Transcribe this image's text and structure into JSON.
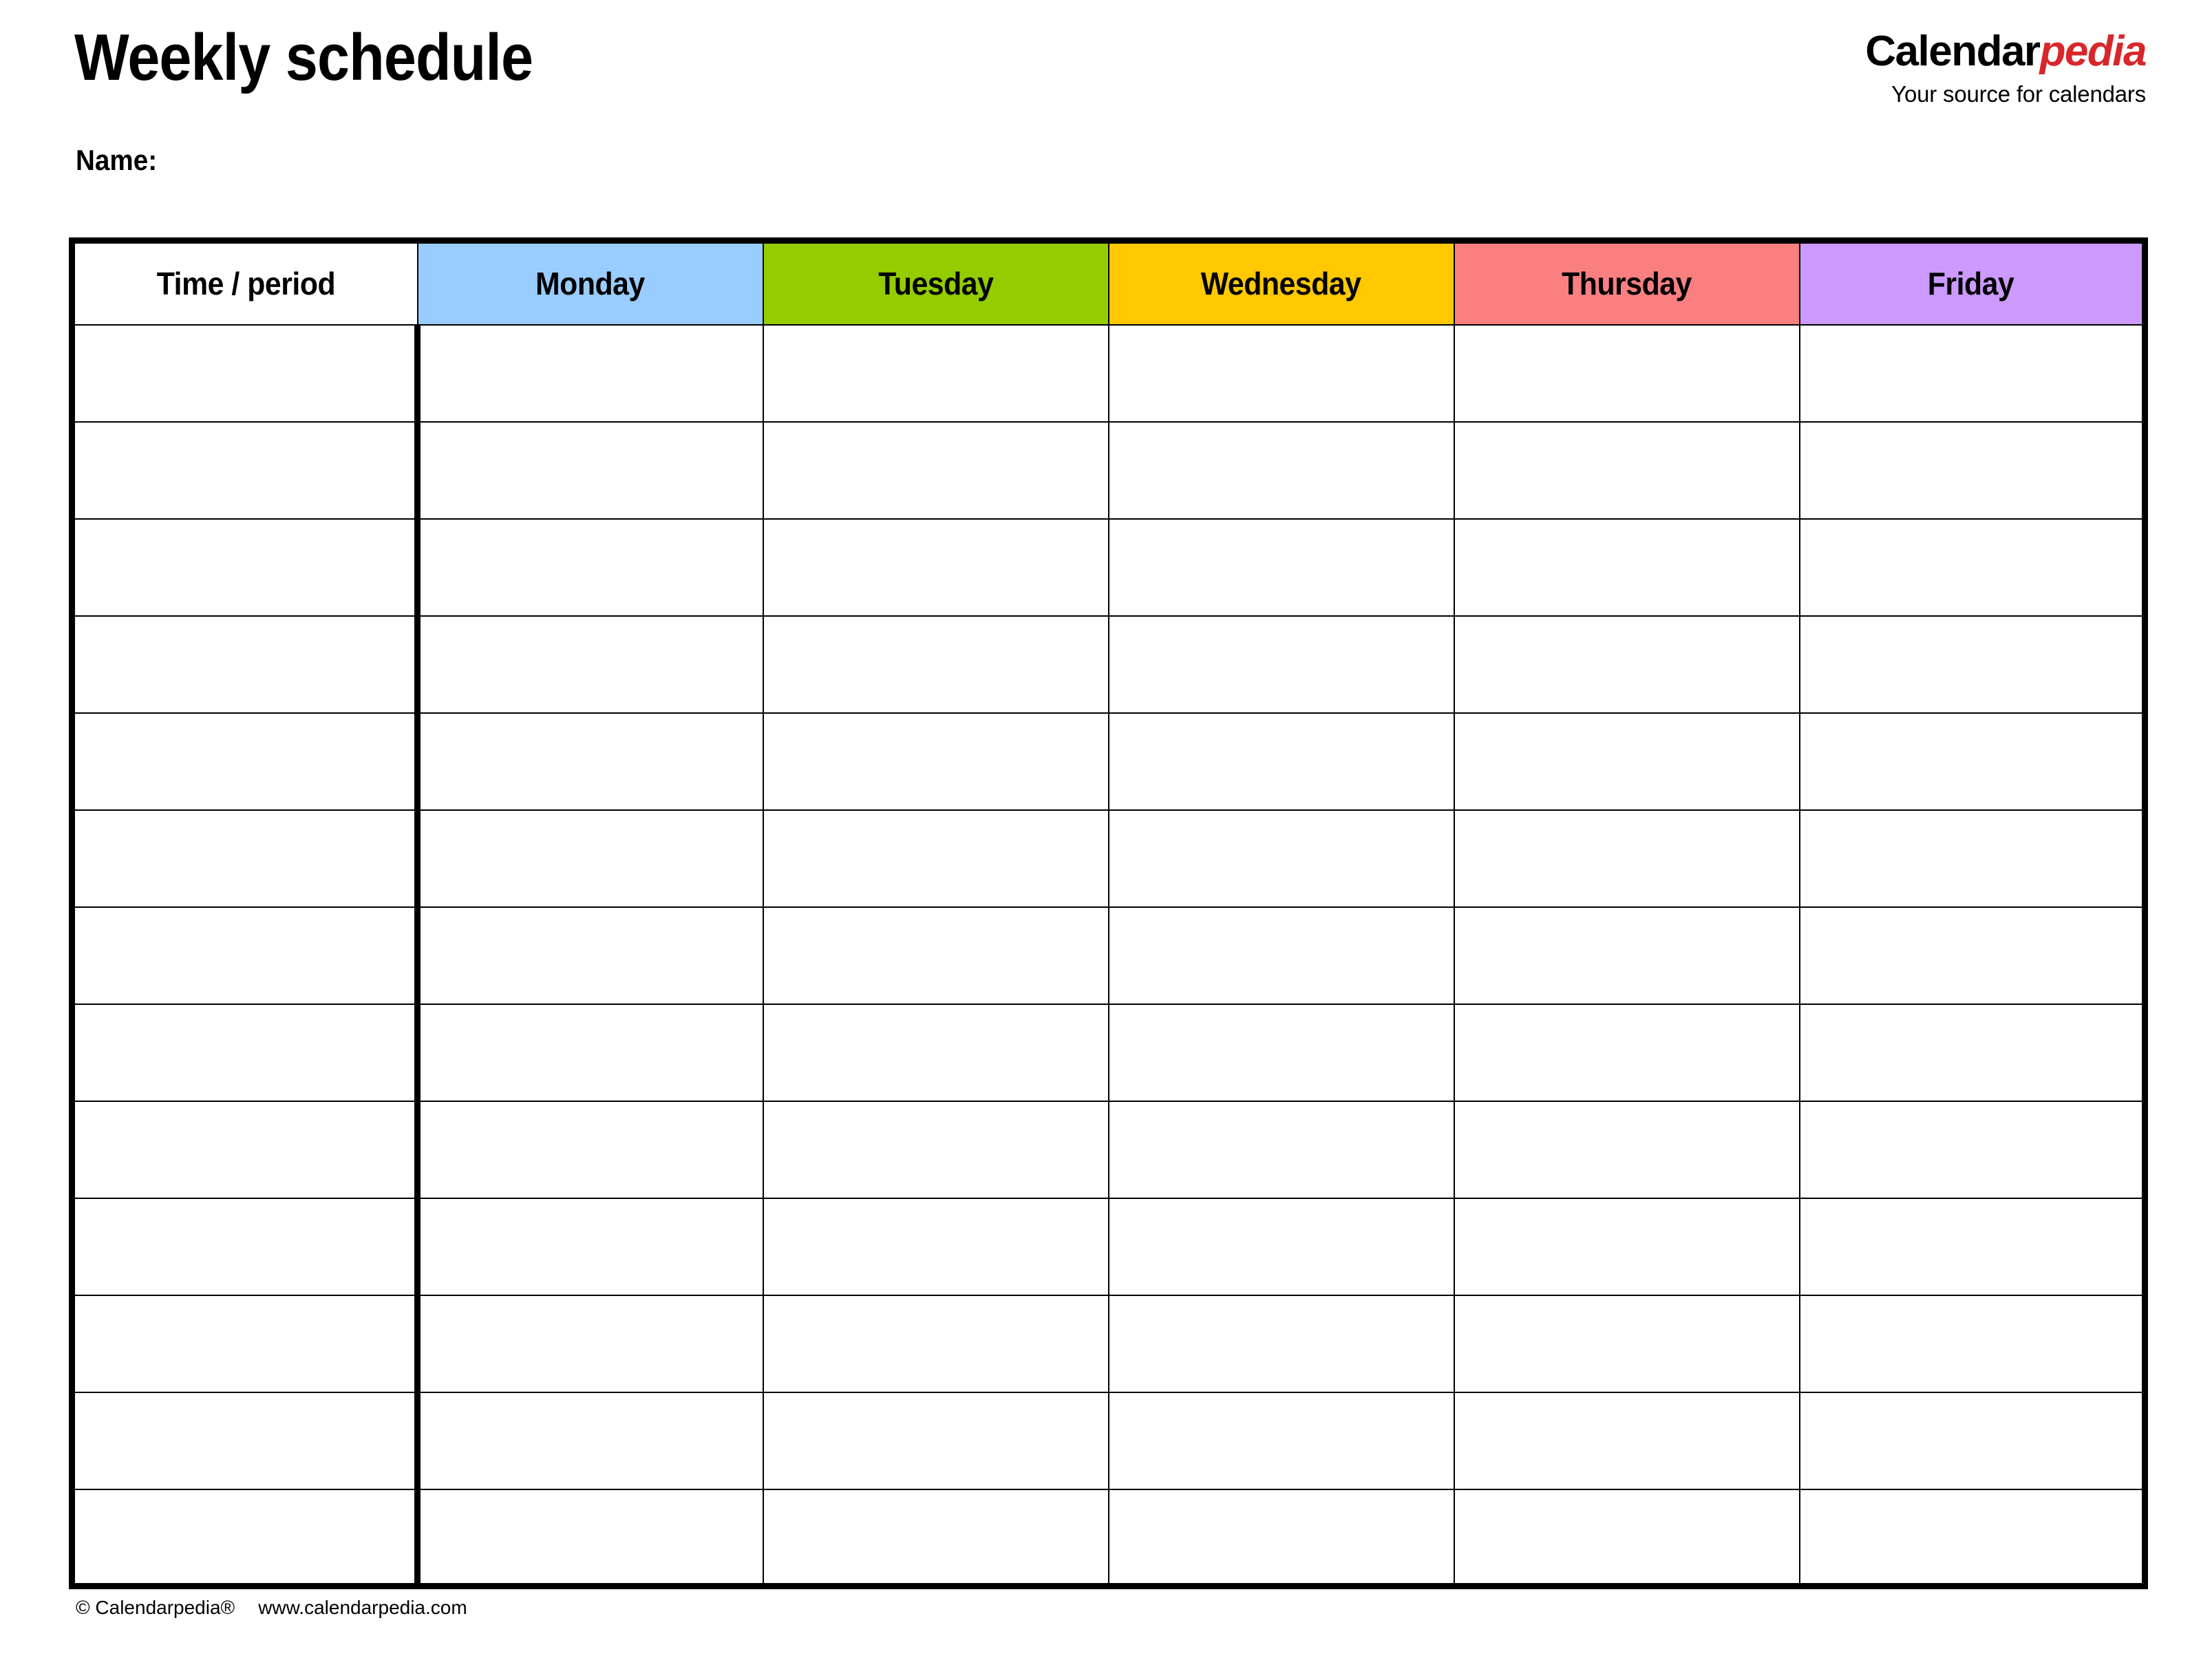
{
  "document": {
    "title": "Weekly schedule",
    "name_label": "Name:"
  },
  "brand": {
    "part_1": "Calendar",
    "part_2": "pedia",
    "tagline": "Your source for calendars",
    "accent_color": "#d8262a"
  },
  "table": {
    "columns": [
      {
        "label": "Time / period",
        "bg": "#ffffff",
        "key": "time"
      },
      {
        "label": "Monday",
        "bg": "#99ccff",
        "key": "monday"
      },
      {
        "label": "Tuesday",
        "bg": "#94cc00",
        "key": "tuesday"
      },
      {
        "label": "Wednesday",
        "bg": "#ffc800",
        "key": "wednesday"
      },
      {
        "label": "Thursday",
        "bg": "#fa7f81",
        "key": "thursday"
      },
      {
        "label": "Friday",
        "bg": "#cc99ff",
        "key": "friday"
      }
    ],
    "row_count": 13,
    "rows": [
      {
        "time": "",
        "monday": "",
        "tuesday": "",
        "wednesday": "",
        "thursday": "",
        "friday": ""
      },
      {
        "time": "",
        "monday": "",
        "tuesday": "",
        "wednesday": "",
        "thursday": "",
        "friday": ""
      },
      {
        "time": "",
        "monday": "",
        "tuesday": "",
        "wednesday": "",
        "thursday": "",
        "friday": ""
      },
      {
        "time": "",
        "monday": "",
        "tuesday": "",
        "wednesday": "",
        "thursday": "",
        "friday": ""
      },
      {
        "time": "",
        "monday": "",
        "tuesday": "",
        "wednesday": "",
        "thursday": "",
        "friday": ""
      },
      {
        "time": "",
        "monday": "",
        "tuesday": "",
        "wednesday": "",
        "thursday": "",
        "friday": ""
      },
      {
        "time": "",
        "monday": "",
        "tuesday": "",
        "wednesday": "",
        "thursday": "",
        "friday": ""
      },
      {
        "time": "",
        "monday": "",
        "tuesday": "",
        "wednesday": "",
        "thursday": "",
        "friday": ""
      },
      {
        "time": "",
        "monday": "",
        "tuesday": "",
        "wednesday": "",
        "thursday": "",
        "friday": ""
      },
      {
        "time": "",
        "monday": "",
        "tuesday": "",
        "wednesday": "",
        "thursday": "",
        "friday": ""
      },
      {
        "time": "",
        "monday": "",
        "tuesday": "",
        "wednesday": "",
        "thursday": "",
        "friday": ""
      },
      {
        "time": "",
        "monday": "",
        "tuesday": "",
        "wednesday": "",
        "thursday": "",
        "friday": ""
      },
      {
        "time": "",
        "monday": "",
        "tuesday": "",
        "wednesday": "",
        "thursday": "",
        "friday": ""
      }
    ]
  },
  "footer": {
    "copyright": "© Calendarpedia®",
    "website": "www.calendarpedia.com"
  }
}
